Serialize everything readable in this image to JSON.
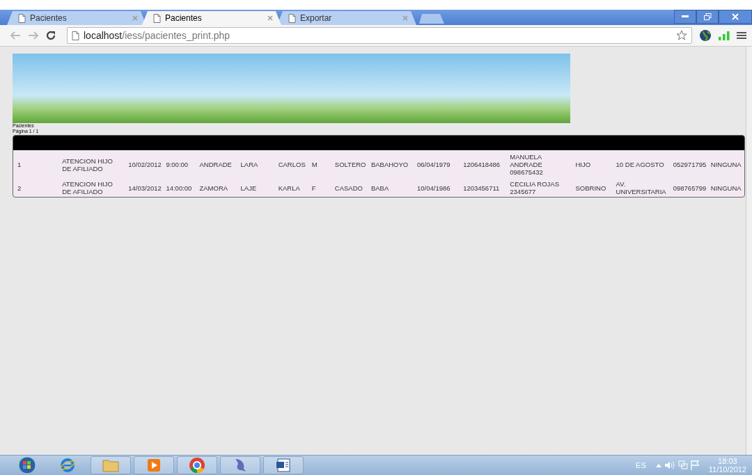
{
  "tabs": [
    {
      "title": "Pacientes",
      "selected": false
    },
    {
      "title": "Pacientes",
      "selected": true
    },
    {
      "title": "Exportar",
      "selected": false
    }
  ],
  "address_bar": {
    "host": "localhost",
    "path": "/iess/pacientes_print.php"
  },
  "report": {
    "title": "Pacientes",
    "page": "Página 1 / 1",
    "rows": [
      [
        "1",
        "ATENCION HIJO DE AFILIADO",
        "10/02/2012",
        "9:00:00",
        "ANDRADE",
        "LARA",
        "CARLOS",
        "M",
        "SOLTERO",
        "BABAHOYO",
        "06/04/1979",
        "1206418486",
        "MANUELA ANDRADE 098675432",
        "HIJO",
        "10 DE AGOSTO",
        "052971795",
        "NINGUNA"
      ],
      [
        "2",
        "ATENCION HIJO DE AFILIADO",
        "14/03/2012",
        "14:00:00",
        "ZAMORA",
        "LAJE",
        "KARLA",
        "F",
        "CASADO",
        "BABA",
        "10/04/1986",
        "1203456711",
        "CECILIA ROJAS 2345677",
        "SOBRINO",
        "AV. UNIVERSITARIA",
        "098765799",
        "NINGUNA"
      ]
    ]
  },
  "taskbar": {
    "language": "ES",
    "time": "18:03",
    "date": "11/10/2012"
  }
}
